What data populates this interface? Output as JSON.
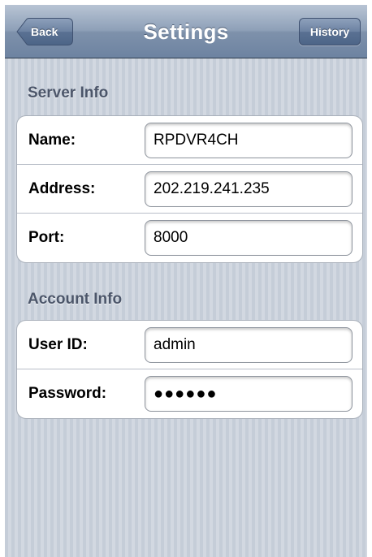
{
  "navbar": {
    "title": "Settings",
    "back_label": "Back",
    "history_label": "History"
  },
  "server_info": {
    "header": "Server Info",
    "rows": [
      {
        "label": "Name:",
        "value": "RPDVR4CH"
      },
      {
        "label": "Address:",
        "value": "202.219.241.235"
      },
      {
        "label": "Port:",
        "value": "8000"
      }
    ]
  },
  "account_info": {
    "header": "Account Info",
    "rows": [
      {
        "label": "User ID:",
        "value": "admin"
      },
      {
        "label": "Password:",
        "value": "●●●●●●"
      }
    ]
  },
  "colors": {
    "navbar": "#7e91ab",
    "background": "#cbd2dc",
    "section_header": "#4c566a"
  },
  "icons": {
    "back": "back-arrow-button"
  }
}
